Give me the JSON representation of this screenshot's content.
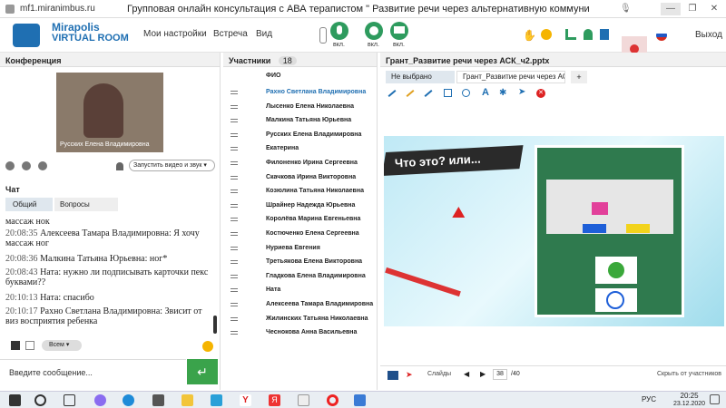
{
  "window": {
    "url": "mf1.miranimbus.ru",
    "title": "Групповая онлайн консультация с АВА терапистом \" Развитие речи через альтернативную коммуникацию\"...."
  },
  "app": {
    "logo_line1": "Mirapolis",
    "logo_line2": "VIRTUAL ROOM",
    "nav": [
      "Мои настройки",
      "Встреча",
      "Вид"
    ],
    "mic_label": "вкл.",
    "cam_label": "вкл.",
    "screen_label": "вкл.",
    "rec_label": "rec",
    "exit_label": "Выход"
  },
  "conference": {
    "header": "Конференция",
    "video_name": "Русских Елена Владимировна",
    "start_button": "Запустить видео и звук"
  },
  "chat": {
    "header": "Чат",
    "tabs": [
      "Общий",
      "Вопросы"
    ],
    "messages": [
      {
        "time": "20:08:35",
        "text": "Малкина Татьяна Юрьевна: Я хочу массаж нок",
        "time_top": ""
      },
      {
        "time": "20:08:35",
        "author": "Алексеева Тамара Владимировна:",
        "text": "Я хочу массаж ног"
      },
      {
        "time": "20:08:36",
        "author": "Малкина Татьяна Юрьевна:",
        "text": "ног*"
      },
      {
        "time": "20:08:43",
        "author": "Ната:",
        "text": "нужно ли подписывать карточки пекс буквами??"
      },
      {
        "time": "20:10:13",
        "author": "Ната:",
        "text": "спасибо"
      },
      {
        "time": "20:10:17",
        "author": "Рахно Светлана Владимировна:",
        "text": "Звисит от виз восприятия ребенка"
      }
    ],
    "partial_top": "массаж нок",
    "recipients": "Всем",
    "input_placeholder": "Введите сообщение..."
  },
  "participants": {
    "header": "Участники",
    "count": "18",
    "column": "ФИО",
    "list": [
      "Рахно Светлана Владимировна",
      "Лысенко Елена Николаевна",
      "Малкина Татьяна Юрьевна",
      "Русских Елена Владимировна",
      "Екатерина",
      "Филоненко Ирина Сергеевна",
      "Скачкова Ирина Викторовна",
      "Козюлина Татьяна Николаевна",
      "Шрайнер Надежда Юрьевна",
      "Королёва Марина Евгеньевна",
      "Костюченко Елена Сергеевна",
      "Нуриева Евгения",
      "Третьякова Елена Викторовна",
      "Гладкова Елена Владимировна",
      "Ната",
      "Алексеева Тамара Владимировна",
      "Жилинских Татьяна Николаевна",
      "Чеснокова Анна Васильевна"
    ]
  },
  "presentation": {
    "header": "Грант_Развитие речи через АСК_ч2.pptx",
    "tabs": [
      "Не выбрано",
      "Грант_Развитие речи через АСК_ч2.pptx"
    ],
    "add_tab": "+",
    "slide_title": "Что это? или...",
    "slides_label": "Слайды",
    "current_slide": "38",
    "total_slides": "/40",
    "hide_label": "Скрыть от участников"
  },
  "taskbar": {
    "lang": "РУС",
    "time": "20:25",
    "date": "23.12.2020"
  },
  "colors": {
    "accent": "#2e9b5e",
    "brand": "#1f6fb2"
  }
}
